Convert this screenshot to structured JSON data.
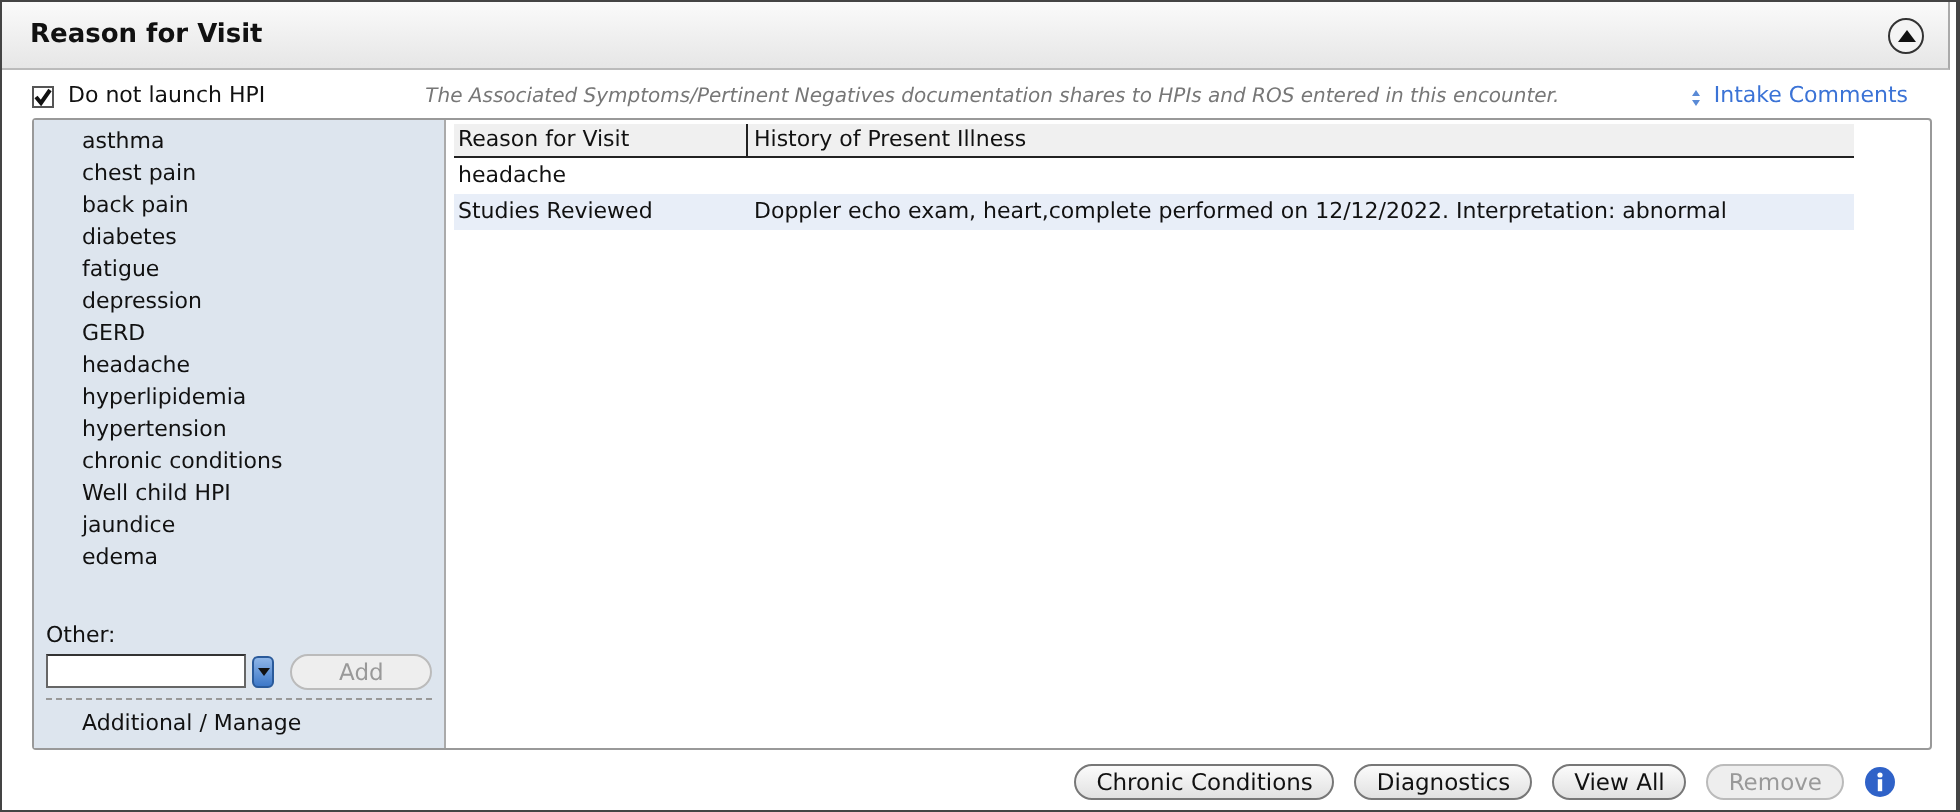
{
  "header": {
    "title": "Reason for Visit",
    "expanded": true
  },
  "do_not_launch": {
    "label": "Do not launch HPI",
    "checked": true
  },
  "note": "The Associated Symptoms/Pertinent Negatives documentation shares to HPIs and ROS entered in this encounter.",
  "intake_link": "Intake Comments",
  "reasons": [
    "asthma",
    "chest pain",
    "back pain",
    "diabetes",
    "fatigue",
    "depression",
    "GERD",
    "headache",
    "hyperlipidemia",
    "hypertension",
    "chronic conditions",
    "Well child HPI",
    "jaundice",
    "edema"
  ],
  "other": {
    "label": "Other:",
    "add_button": {
      "label": "Add",
      "disabled": true
    }
  },
  "manage_link": "Additional / Manage",
  "table": {
    "columns": [
      "Reason for Visit",
      "History of Present Illness"
    ],
    "rows": [
      {
        "cells": [
          "headache",
          ""
        ],
        "selected": false
      },
      {
        "cells": [
          "Studies Reviewed",
          "Doppler echo exam, heart,complete performed on 12/12/2022. Interpretation: abnormal"
        ],
        "selected": true
      }
    ]
  },
  "buttons": [
    {
      "label": "Chronic Conditions",
      "disabled": false
    },
    {
      "label": "Diagnostics",
      "disabled": false
    },
    {
      "label": "View All",
      "disabled": false
    },
    {
      "label": "Remove",
      "disabled": true
    }
  ]
}
